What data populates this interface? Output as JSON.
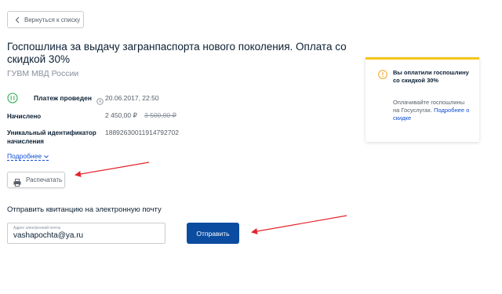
{
  "nav": {
    "back_label": "Вернуться к списку"
  },
  "header": {
    "title": "Госпошлина за выдачу загранпаспорта нового поколения. Оплата со скидкой 30%",
    "organization": "ГУВМ МВД России"
  },
  "payment": {
    "status": "Платеж проведен",
    "datetime": "20.06.2017, 22:50",
    "accrued_label": "Начислено",
    "accrued_value": "2 450,00 ₽",
    "accrued_old_value": "3 500,00 ₽",
    "uid_label": "Уникальный идентификатор начисления",
    "uid_value": "18892630011914792702",
    "more_label": "Подробнее"
  },
  "actions": {
    "print_label": "Распечатать"
  },
  "email": {
    "heading": "Отправить квитанцию на электронную почту",
    "placeholder": "Адрес электронной почты",
    "value": "vashapochta@ya.ru",
    "send_label": "Отправить"
  },
  "info_card": {
    "title": "Вы оплатили госпошлину со скидкой 30%",
    "body": "Оплачивайте госпошлины на Госуслугах.",
    "link_label": "Подробнее о скидке"
  },
  "colors": {
    "accent_blue": "#0b4ca0",
    "link_blue": "#0d4cd3",
    "success_green": "#4fba6f",
    "warning_yellow": "#f5c518",
    "annotation_red": "#e3242b"
  },
  "icons": {
    "back": "chevron-left-icon",
    "status": "success-icon",
    "time": "clock-icon",
    "more": "chevron-down-icon",
    "print": "printer-icon",
    "info": "warning-icon"
  }
}
